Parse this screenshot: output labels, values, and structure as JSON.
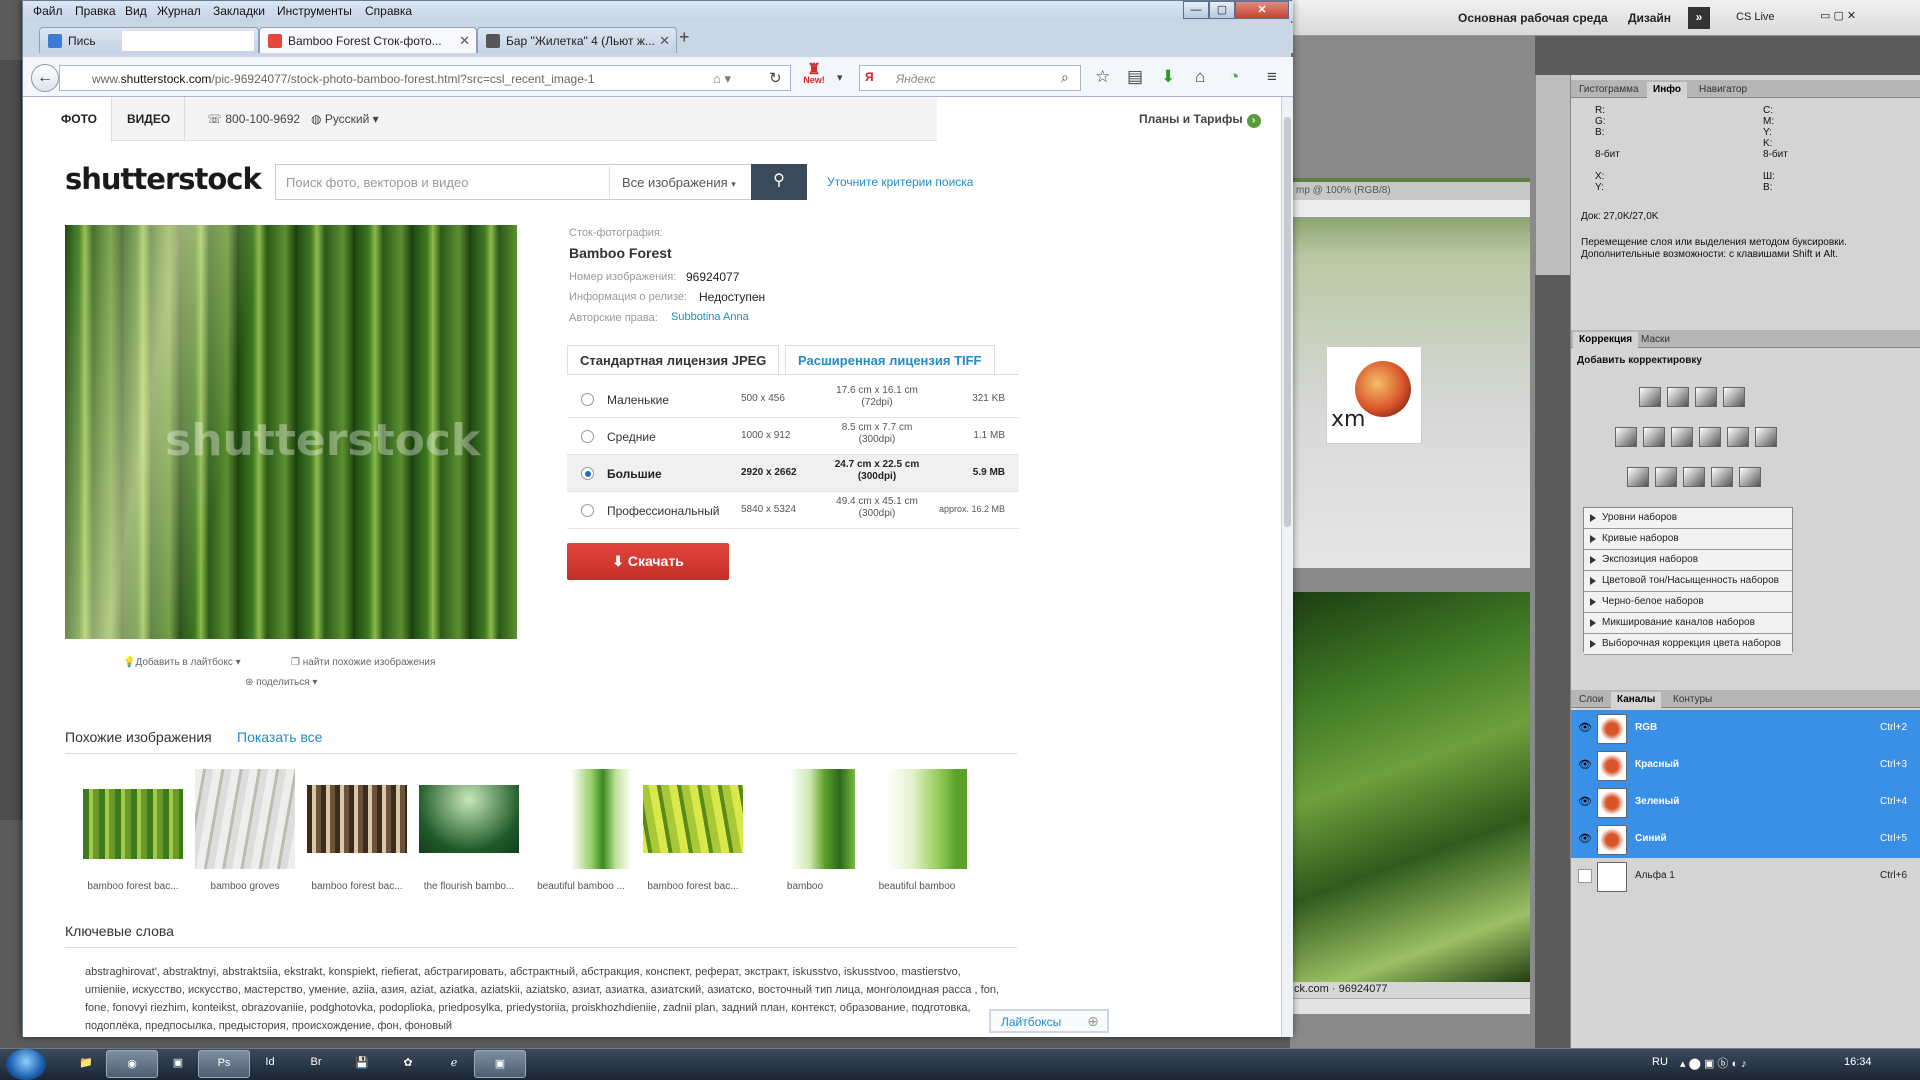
{
  "photoshop": {
    "workspace_label": "Основная рабочая среда",
    "design_label": "Дизайн",
    "cslive_label": "CS Live",
    "doc1_title": "mp @ 100% (RGB/8)",
    "doc2_status": "ck.com · 96924077",
    "info_panel": {
      "tabs": [
        "Гистограмма",
        "Инфо",
        "Навигатор"
      ],
      "rgb_block": "R:\nG:\nB:\n\n8-бит",
      "cmyk_block": "C:\nM:\nY:\nK:\n8-бит",
      "xy_block": "X:\nY:",
      "wh_block": "Ш:\nВ:",
      "doc_size": "Док: 27,0K/27,0K",
      "hint": "Перемещение слоя или выделения методом буксировки.\nДополнительные возможности: с клавишами Shift и Alt."
    },
    "adjust_panel": {
      "tabs": [
        "Коррекция",
        "Маски"
      ],
      "title": "Добавить корректировку",
      "presets": [
        "Уровни наборов",
        "Кривые наборов",
        "Экспозиция наборов",
        "Цветовой тон/Насыщенность наборов",
        "Черно-белое наборов",
        "Микширование каналов наборов",
        "Выборочная коррекция цвета наборов"
      ]
    },
    "channels_panel": {
      "tabs": [
        "Слои",
        "Каналы",
        "Контуры"
      ],
      "channels": [
        {
          "name": "RGB",
          "shortcut": "Ctrl+2"
        },
        {
          "name": "Красный",
          "shortcut": "Ctrl+3"
        },
        {
          "name": "Зеленый",
          "shortcut": "Ctrl+4"
        },
        {
          "name": "Синий",
          "shortcut": "Ctrl+5"
        },
        {
          "name": "Альфа 1",
          "shortcut": "Ctrl+6"
        }
      ]
    }
  },
  "firefox": {
    "menu": [
      "Файл",
      "Правка",
      "Вид",
      "Журнал",
      "Закладки",
      "Инструменты",
      "Справка"
    ],
    "tabs": [
      {
        "label": "Пись"
      },
      {
        "label": "Bamboo Forest Сток-фото..."
      },
      {
        "label": "Бар \"Жилетка\" 4 (Льют ж..."
      }
    ],
    "url_prefix": "www.",
    "url_host": "shutterstock.com",
    "url_path": "/pic-96924077/stock-photo-bamboo-forest.html?src=csl_recent_image-1",
    "search_placeholder": "Яндекс",
    "new_badge": "New!"
  },
  "site": {
    "tab_photo": "ФОТО",
    "tab_video": "ВИДЕО",
    "phone": "800-100-9692",
    "language": "Русский",
    "plans": "Планы и Тарифы",
    "logo": "shutterstock",
    "search_placeholder": "Поиск фото, векторов и видео",
    "search_scope": "Все изображения",
    "refine": "Уточните критерии поиска",
    "watermark": "shutterstock",
    "meta": {
      "kind_label": "Сток-фотография:",
      "title": "Bamboo Forest",
      "id_label": "Номер изображения:",
      "id_value": "96924077",
      "release_label": "Информация о релизе:",
      "release_value": "Недоступен",
      "author_label": "Авторские права:",
      "author_value": "Subbotina Anna"
    },
    "license_tabs": [
      "Стандартная лицензия JPEG",
      "Расширенная лицензия TIFF"
    ],
    "sizes": [
      {
        "name": "Маленькие",
        "px": "500 x 456",
        "cm": "17.6 cm x 16.1 cm",
        "dpi": "(72dpi)",
        "size": "321 KB"
      },
      {
        "name": "Средние",
        "px": "1000 x 912",
        "cm": "8.5 cm x 7.7 cm",
        "dpi": "(300dpi)",
        "size": "1.1 MB"
      },
      {
        "name": "Большие",
        "px": "2920 x 2662",
        "cm": "24.7 cm x 22.5 cm",
        "dpi": "(300dpi)",
        "size": "5.9 MB"
      },
      {
        "name": "Профессиональный",
        "px": "5840 x 5324",
        "cm": "49.4 cm x 45.1 cm",
        "dpi": "(300dpi)",
        "size": "approx. 16.2 MB"
      }
    ],
    "selected_size": "Большие",
    "download": "Скачать",
    "add_lightbox": "Добавить в лайтбокс",
    "find_similar": "найти похожие изображения",
    "share": "поделиться",
    "similar_heading": "Похожие изображения",
    "show_all": "Показать все",
    "similar": [
      {
        "caption": "bamboo forest bac..."
      },
      {
        "caption": "bamboo groves"
      },
      {
        "caption": "bamboo forest bac..."
      },
      {
        "caption": "the flourish bambo..."
      },
      {
        "caption": "beautiful bamboo ..."
      },
      {
        "caption": "bamboo forest bac..."
      },
      {
        "caption": "bamboo"
      },
      {
        "caption": "beautiful bamboo"
      }
    ],
    "keywords_heading": "Ключевые слова",
    "keywords": "abstraghirovat', abstraktnyi, abstraktsiia, ekstrakt, konspiekt, riefierat, абстрагировать, абстрактный, абстракция, конспект, реферат, экстракт, iskusstvo, iskusstvoo, mastierstvo, umieniie, искусство, искусство, мастерство, умение, aziia, азия, aziat, aziatka, aziatskii, aziatsko, азиат, азиатка, азиатский, азиатско, восточный тип лица, монголоидная расса , fon, fone, fonovyi riezhim, konteikst, obrazovaniie, podghotovka, podoplioka, priedposylka, priedystoriia, proiskhozhdieniie, zadnii plan, задний план, контекст, образование, подготовка, подоплёка, предпосылка, предыстория, происхождение, фон, фоновый",
    "lightboxes": "Лайтбоксы"
  },
  "taskbar": {
    "lang": "RU",
    "time": "16:34"
  }
}
